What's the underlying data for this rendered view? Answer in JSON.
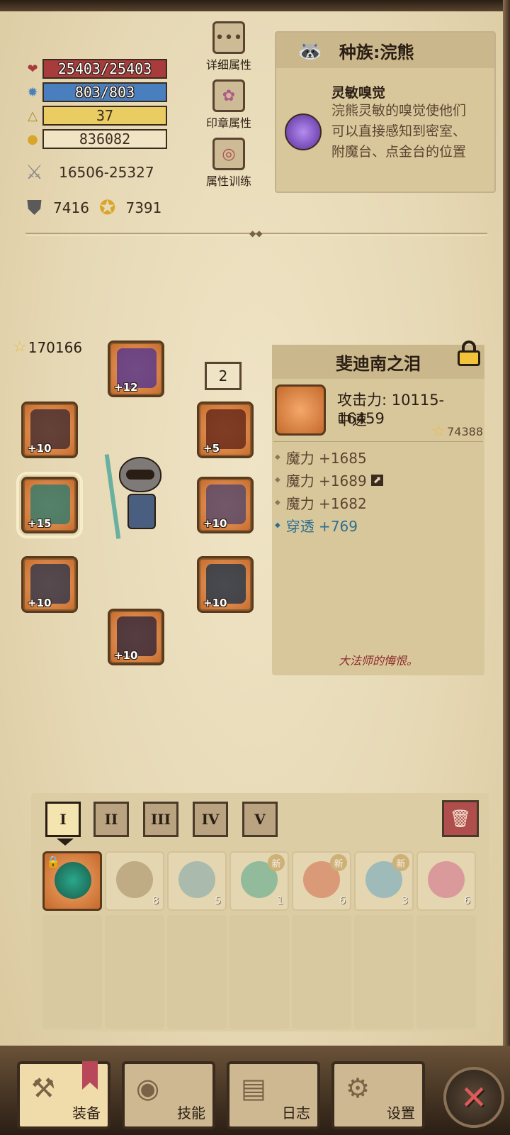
{
  "stats": {
    "hp": "25403/25403",
    "mp": "803/803",
    "level": "37",
    "gold": "836082",
    "attack": "16506-25327",
    "defense": "7416",
    "magic_defense": "7391"
  },
  "side_buttons": [
    {
      "label": "详细属性",
      "icon": "ellipsis-icon"
    },
    {
      "label": "印章属性",
      "icon": "seal-icon"
    },
    {
      "label": "属性训练",
      "icon": "target-icon"
    }
  ],
  "race": {
    "title": "种族:浣熊",
    "trait_name": "灵敏嗅觉",
    "trait_desc": "浣熊灵敏的嗅觉使他们可以直接感知到密室、附魔台、点金台的位置"
  },
  "equipment": {
    "total_score": "170166",
    "set_count": "2",
    "slots": [
      {
        "name": "helmet",
        "plus": "+12"
      },
      {
        "name": "necklace",
        "plus": "+10"
      },
      {
        "name": "armor",
        "plus": "+5"
      },
      {
        "name": "weapon",
        "plus": "+15"
      },
      {
        "name": "offhand",
        "plus": "+10"
      },
      {
        "name": "gloves",
        "plus": "+10"
      },
      {
        "name": "ring",
        "plus": "+10"
      },
      {
        "name": "boots",
        "plus": "+10"
      }
    ]
  },
  "item": {
    "name": "斐迪南之泪",
    "attack": "攻击力: 10115-16459",
    "speed": "中速",
    "score": "74388",
    "affixes": [
      {
        "text": "魔力 +1685",
        "color": "normal"
      },
      {
        "text": "魔力 +1689",
        "color": "normal"
      },
      {
        "text": "魔力 +1682",
        "color": "normal"
      },
      {
        "text": "穿透 +769",
        "color": "blue"
      }
    ],
    "flavor": "大法师的悔恨。"
  },
  "inventory": {
    "tabs": [
      "I",
      "II",
      "III",
      "IV",
      "V"
    ],
    "active_tab": "I",
    "new_tag": "新",
    "items": [
      {
        "icon": "portal-icon",
        "count": "",
        "locked": true,
        "new": false
      },
      {
        "icon": "pickaxe-icon",
        "count": "8",
        "locked": false,
        "new": false
      },
      {
        "icon": "eye-scroll-icon",
        "count": "5",
        "locked": false,
        "new": false
      },
      {
        "icon": "potion-green-icon",
        "count": "1",
        "locked": false,
        "new": true
      },
      {
        "icon": "potion-red-icon",
        "count": "6",
        "locked": false,
        "new": true
      },
      {
        "icon": "potion-blue-icon",
        "count": "3",
        "locked": false,
        "new": true
      },
      {
        "icon": "potion-pink-icon",
        "count": "6",
        "locked": false,
        "new": false
      }
    ]
  },
  "nav": [
    {
      "label": "装备",
      "icon": "axe-icon",
      "active": true
    },
    {
      "label": "技能",
      "icon": "skill-icon",
      "active": false
    },
    {
      "label": "日志",
      "icon": "journal-icon",
      "active": false
    },
    {
      "label": "设置",
      "icon": "gear-icon",
      "active": false
    }
  ],
  "colors": {
    "hp_bar": "#a83b3b",
    "mp_bar": "#4a7fbf",
    "level_bar": "#e9cc62",
    "penetration_text": "#2c6e90",
    "flavor_text": "#8a2a2a"
  }
}
